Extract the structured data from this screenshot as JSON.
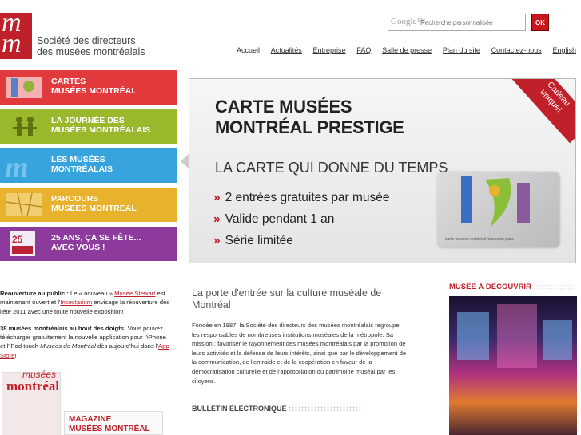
{
  "logo": {
    "mark": "m m",
    "line1": "Société des directeurs",
    "line2": "des musées montréalais"
  },
  "search": {
    "google": "Google™",
    "placeholder": "Recherche personnalisée",
    "button": "OK"
  },
  "nav": [
    "Accueil",
    "Actualités",
    "Entreprise",
    "FAQ",
    "Salle de presse",
    "Plan du site",
    "Contactez-nous",
    "English"
  ],
  "menu": [
    {
      "line1": "CARTES",
      "line2": "MUSÉES MONTRÉAL",
      "color": "#e23a3c",
      "icon": "museum-card-icon"
    },
    {
      "line1": "LA JOURNÉE DES",
      "line2": "MUSÉES MONTRÉALAIS",
      "color": "#9ab82c",
      "icon": "people-icon"
    },
    {
      "line1": "LES MUSÉES",
      "line2": "MONTRÉALAIS",
      "color": "#37a4dd",
      "icon": "m-logo-icon"
    },
    {
      "line1": "PARCOURS",
      "line2": "MUSÉES MONTRÉAL",
      "color": "#e9b22c",
      "icon": "map-icon"
    },
    {
      "line1": "25 ANS, ÇA SE FÊTE...",
      "line2": "AVEC VOUS !",
      "color": "#8c3a9c",
      "icon": "25-years-icon"
    }
  ],
  "banner": {
    "title1": "CARTE MUSÉES",
    "title2": "MONTRÉAL PRESTIGE",
    "subtitle": "LA CARTE QUI DONNE DU TEMPS",
    "bullet_mark": "»",
    "bullets": [
      "2 entrées gratuites par musée",
      "Valide pendant 1 an",
      "Série limitée"
    ],
    "corner1": "Cadeau",
    "corner2": "unique!",
    "card_caption": "carte musées montréal museums pass"
  },
  "left": {
    "p1_lead": "Réouverture au public :",
    "p1_a": " Le « nouveau » ",
    "p1_link1": "Musée Stewart",
    "p1_b": " est maintenant ouvert et l'",
    "p1_link2": "Insectarium",
    "p1_c": " envisage la réouverture dès l'été 2011 avec une toute nouvelle exposition!",
    "p2_lead": "38 musées montréalais au bout des doigts!",
    "p2_a": " Vous pouvez télécharger gratuitement la nouvelle application pour l'iPhone et l'iPod touch ",
    "p2_italic": "Musées de Montréal",
    "p2_b": " dès aujourd'hui dans l'",
    "p2_link": "App Store",
    "p2_c": "!"
  },
  "magazine": {
    "m1": "musées",
    "m2": "montréal",
    "title1": "MAGAZINE",
    "title2": "MUSÉES MONTRÉAL"
  },
  "center": {
    "title": "La porte d'entrée sur la culture muséale de Montréal",
    "intro": "Fondée en 1987, la Société des directeurs des musées montréalais regroupe les responsables de nombreuses institutions muséales de la métropole. Sa mission : favoriser le rayonnement des musées montréalais par la promotion de leurs activités et la défense de leurs intérêts, ainsi que par le développement de la communication, de l'entraide et de la coopération en faveur de la démocratisation culturelle et de l'appropriation du patrimoine muséal par les citoyens.",
    "bulletin": "BULLETIN ÉLECTRONIQUE",
    "dots": ":::::::::::::::::::::::"
  },
  "right": {
    "title": "MUSÉE À DÉCOUVRIR",
    "dots": "::::::::::::::"
  }
}
